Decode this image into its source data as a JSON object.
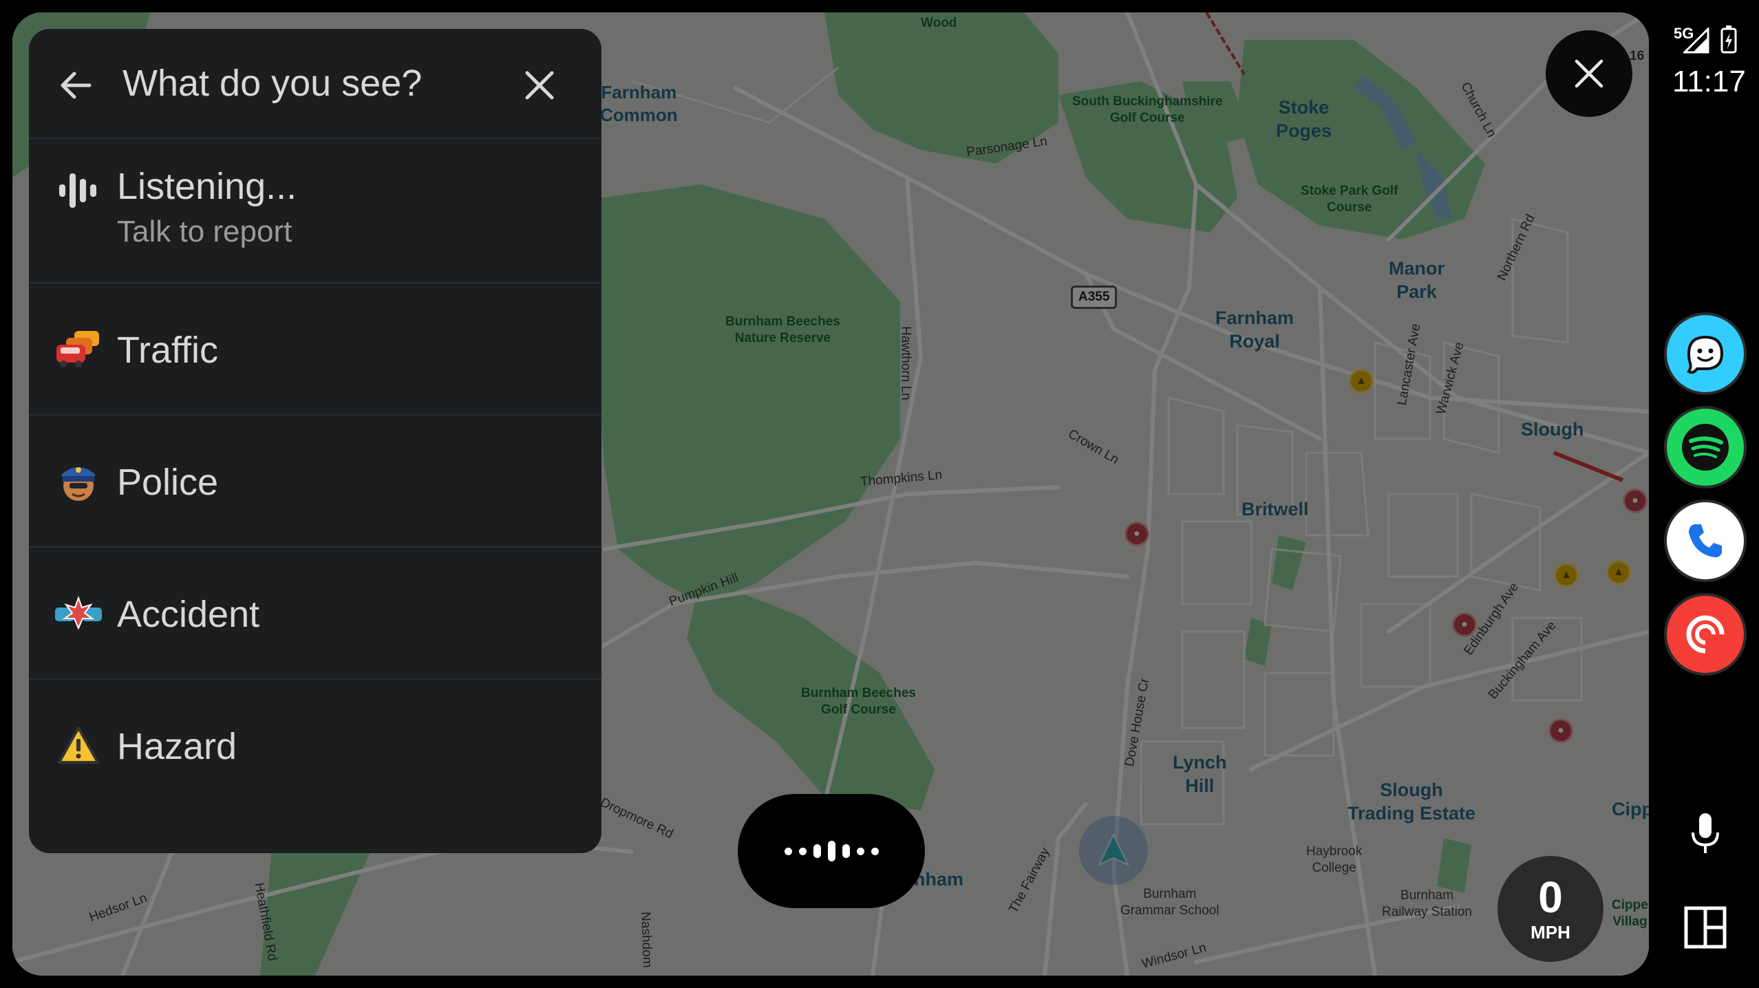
{
  "report_panel": {
    "title": "What do you see?",
    "listening_title": "Listening...",
    "listening_subtitle": "Talk to report",
    "items": [
      {
        "label": "Traffic",
        "icon": "traffic-jam-icon"
      },
      {
        "label": "Police",
        "icon": "police-icon"
      },
      {
        "label": "Accident",
        "icon": "accident-icon"
      },
      {
        "label": "Hazard",
        "icon": "hazard-warning-icon"
      }
    ]
  },
  "map": {
    "road_shield": "A355",
    "labels": {
      "wood": "Wood",
      "farnham_common": "Farnham\nCommon",
      "south_bucks_golf": "South Buckinghamshire\nGolf Course",
      "stoke_poges": "Stoke\nPoges",
      "church_ln": "Church Ln",
      "parsonage_ln": "Parsonage Ln",
      "stoke_park_golf": "Stoke Park Golf\nCourse",
      "burnham_beeches_nr": "Burnham Beeches\nNature Reserve",
      "hawthorn_ln": "Hawthorn Ln",
      "manor_park": "Manor\nPark",
      "farnham_royal": "Farnham\nRoyal",
      "crown_ln": "Crown Ln",
      "slough": "Slough",
      "thompkins_ln": "Thompkins Ln",
      "britwell": "Britwell",
      "pumpkin_hill": "Pumpkin Hill",
      "burnham_beeches_golf": "Burnham Beeches\nGolf Course",
      "dropmore_rd": "Dropmore Rd",
      "dove_house_cr": "Dove House Cr",
      "lynch_hill": "Lynch\nHill",
      "slough_trading_estate": "Slough\nTrading Estate",
      "haybrook_college": "Haybrook\nCollege",
      "burnham_grammar": "Burnham\nGrammar School",
      "burnham_railway": "Burnham\nRailway Station",
      "burnham": "nham",
      "hedsor_ln": "Hedsor Ln",
      "heathfield_rd": "Heathfield Rd",
      "nashdom": "Nashdom",
      "the_fairway": "The Fairway",
      "windsor_ln": "Windsor Ln",
      "cippenham": "Cipp",
      "cippenham_village": "Cippe\nVillag",
      "edinburgh_ave": "Edinburgh Ave",
      "buckingham_ave": "Buckingham Ave",
      "lancaster_ave": "Lancaster Ave",
      "warwick_ave": "Warwick Ave",
      "northern_rd": "Northern Rd",
      "shield_16": "16"
    }
  },
  "speed": {
    "value": "0",
    "unit": "MPH"
  },
  "status_bar": {
    "network": "5G",
    "time": "11:17"
  },
  "rail_apps": [
    {
      "name": "waze-app-icon",
      "color": "#33ccff"
    },
    {
      "name": "spotify-app-icon",
      "color": "#1ed760"
    },
    {
      "name": "phone-app-icon",
      "color": "#ffffff"
    },
    {
      "name": "pocket-casts-app-icon",
      "color": "#f43e37"
    }
  ]
}
